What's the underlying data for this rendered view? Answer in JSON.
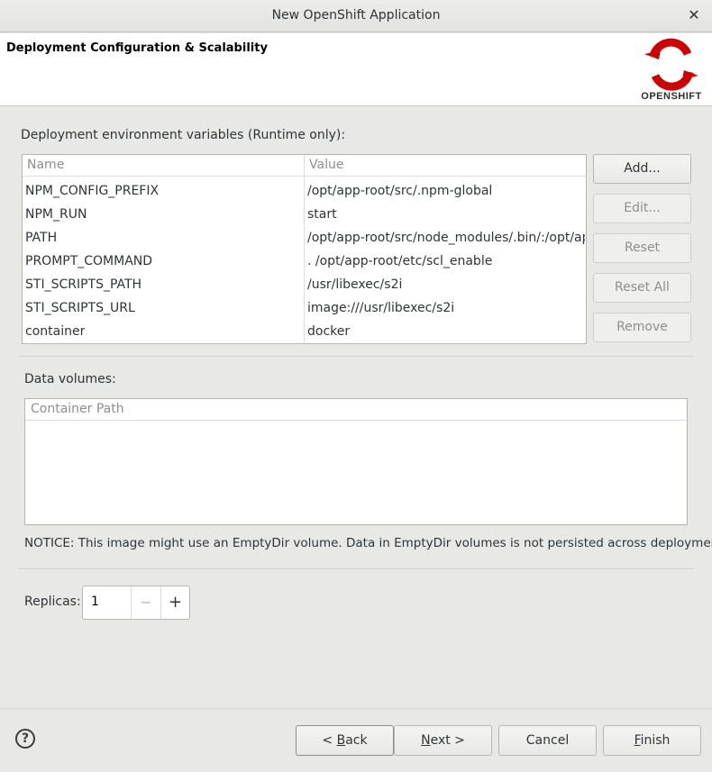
{
  "window": {
    "title": "New OpenShift Application",
    "close_glyph": "✕"
  },
  "header": {
    "title": "Deployment Configuration & Scalability",
    "logo_text": "OPENSHIFT",
    "logo_color": "#cc0000"
  },
  "env": {
    "label": "Deployment environment variables (Runtime only):",
    "columns": [
      "Name",
      "Value"
    ],
    "rows": [
      {
        "name": "NPM_CONFIG_PREFIX",
        "value": "/opt/app-root/src/.npm-global"
      },
      {
        "name": "NPM_RUN",
        "value": "start"
      },
      {
        "name": "PATH",
        "value": "/opt/app-root/src/node_modules/.bin/:/opt/app-"
      },
      {
        "name": "PROMPT_COMMAND",
        "value": ". /opt/app-root/etc/scl_enable"
      },
      {
        "name": "STI_SCRIPTS_PATH",
        "value": "/usr/libexec/s2i"
      },
      {
        "name": "STI_SCRIPTS_URL",
        "value": "image:///usr/libexec/s2i"
      },
      {
        "name": "container",
        "value": "docker"
      }
    ],
    "buttons": {
      "add": "Add...",
      "edit": "Edit...",
      "reset": "Reset",
      "reset_all": "Reset All",
      "remove": "Remove"
    }
  },
  "volumes": {
    "label": "Data volumes:",
    "column": "Container Path",
    "notice": "NOTICE: This image might use an EmptyDir volume. Data in EmptyDir volumes is not persisted across deployments."
  },
  "replicas": {
    "label": "Replicas:",
    "value": "1",
    "minus": "−",
    "plus": "+"
  },
  "footer": {
    "help": "?",
    "back_prefix": "< ",
    "back_mnemonic": "B",
    "back_rest": "ack",
    "next_mnemonic": "N",
    "next_rest": "ext >",
    "cancel": "Cancel",
    "finish_mnemonic": "F",
    "finish_rest": "inish"
  }
}
